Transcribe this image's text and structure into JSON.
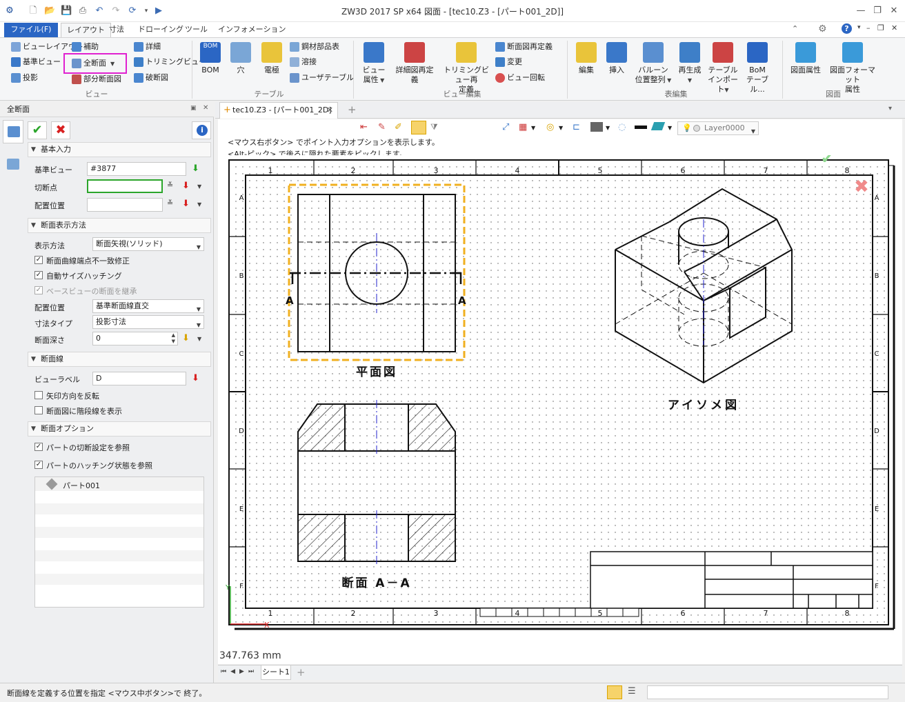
{
  "window": {
    "title": "ZW3D 2017 SP x64          図面 - [tec10.Z3 - [パート001_2D]]"
  },
  "menu": {
    "tabs": [
      "ファイル(F)",
      "レイアウト",
      "寸法",
      "ドローイング",
      "ツール",
      "インフォメーション"
    ]
  },
  "ribbon": {
    "view": {
      "group_label": "ビュー",
      "view_layout": "ビューレイアウト",
      "base_view": "基準ビュー",
      "projection": "投影",
      "auxiliary": "補助",
      "full_section": "全断面",
      "partial_section": "部分断面図",
      "detail": "詳細",
      "trimming_view": "トリミングビュー",
      "broken_view": "破断図"
    },
    "table": {
      "group_label": "テーブル",
      "bom": "BOM",
      "hole": "穴",
      "electrode": "電極",
      "steel_parts": "鋼材部品表",
      "weld": "溶接",
      "user_table": "ユーザテーブル"
    },
    "view_edit": {
      "group_label": "ビュー編集",
      "view_attr_l1": "ビュー",
      "view_attr_l2": "属性",
      "detail_redefine_l1": "詳細図再定",
      "detail_redefine_l2": "義",
      "trimming_redefine_l1": "トリミングビュー再",
      "trimming_redefine_l2": "定義",
      "section_redefine": "断面図再定義",
      "change": "変更",
      "view_rotate": "ビュー回転"
    },
    "table_edit": {
      "group_label": "表編集",
      "edit": "編集",
      "insert": "挿入",
      "balloon_l1": "バルーン",
      "balloon_l2": "位置整列",
      "regenerate": "再生成",
      "table_import_l1": "テーブル",
      "table_import_l2": "インポート",
      "bom_table_l1": "BoM",
      "bom_table_l2": "テーブル..."
    },
    "drawing": {
      "group_label": "図面",
      "drawing_attr": "図面属性",
      "drawing_format_l1": "図面フォーマット",
      "drawing_format_l2": "属性"
    }
  },
  "panel": {
    "title": "全断面",
    "basic_input": {
      "header": "基本入力",
      "base_view_label": "基準ビュー",
      "base_view_value": "#3877",
      "cut_point_label": "切断点",
      "cut_point_value": "",
      "placement_label": "配置位置",
      "placement_value": ""
    },
    "display_method": {
      "header": "断面表示方法",
      "display_label": "表示方法",
      "display_value": "断面矢視(ソリッド)",
      "opt1": "断面曲線端点不一致修正",
      "opt2": "自動サイズハッチング",
      "opt3": "ベースビューの断面を継承",
      "placement_label": "配置位置",
      "placement_value": "基準断面線直交",
      "dim_type_label": "寸法タイプ",
      "dim_type_value": "投影寸法",
      "depth_label": "断面深さ",
      "depth_value": "0"
    },
    "section_line": {
      "header": "断面線",
      "view_label_label": "ビューラベル",
      "view_label_value": "D",
      "opt1": "矢印方向を反転",
      "opt2": "断面図に階段線を表示"
    },
    "section_options": {
      "header": "断面オプション",
      "opt1": "パートの切断設定を参照",
      "opt2": "パートのハッチング状態を参照",
      "part_item": "パート001"
    }
  },
  "document": {
    "tab_label": "tec10.Z3 - [パート001_2D]",
    "hint1": "<マウス右ボタン> でポイント入力オプションを表示します。",
    "hint2": "<Alt-ピック> で後ろに隠れた要素をピックします。",
    "layer": "Layer0000",
    "measure": "347.763 mm",
    "sheet_tab": "シート1",
    "col_labels": [
      "1",
      "2",
      "3",
      "4",
      "5",
      "6",
      "7",
      "8"
    ],
    "row_labels": [
      "A",
      "B",
      "C",
      "D",
      "E",
      "F"
    ],
    "view_plan": "平面図",
    "view_iso": "アイソメ図",
    "view_section": "断面 A－A",
    "section_letter": "A"
  },
  "statusbar": {
    "message": "断面線を定義する位置を指定  <マウス中ボタン>で 終了。"
  },
  "colors": {
    "accent": "#2b66c4",
    "highlight": "#e020d0",
    "selection": "#f0b020",
    "ok": "#2aa52a",
    "cancel": "#d82020"
  }
}
